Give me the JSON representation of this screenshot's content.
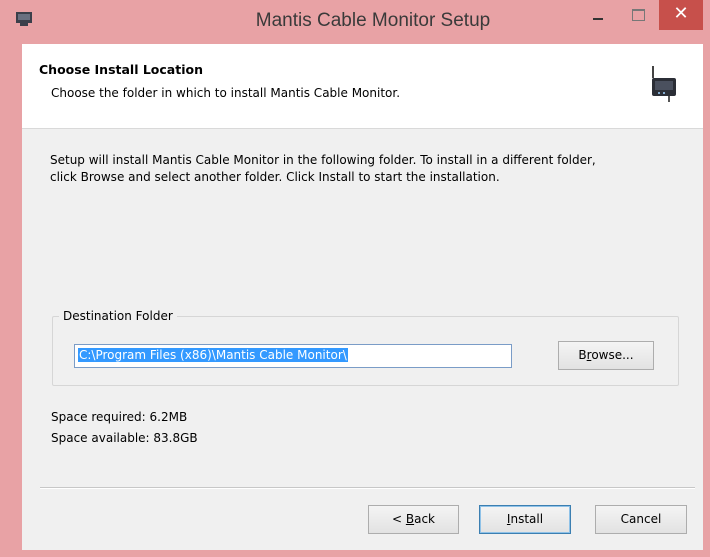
{
  "window": {
    "title": "Mantis Cable Monitor Setup",
    "icon": "installer-icon",
    "controls": {
      "minimize": "minimize-icon",
      "maximize": "maximize-icon",
      "close": "close-icon"
    },
    "accent_color": "#e8a2a5",
    "close_color": "#c7504b"
  },
  "header": {
    "title": "Choose Install Location",
    "subtitle": "Choose the folder in which to install Mantis Cable Monitor.",
    "icon": "device-icon"
  },
  "intro": {
    "line1": "Setup will install Mantis Cable Monitor in the following folder. To install in a different folder,",
    "line2": "click Browse and select another folder. Click Install to start the installation."
  },
  "destination": {
    "legend": "Destination Folder",
    "path": "C:\\Program Files (x86)\\Mantis Cable Monitor\\",
    "browse_prefix": "B",
    "browse_accel": "r",
    "browse_suffix": "owse..."
  },
  "space": {
    "required": "Space required: 6.2MB",
    "available": "Space available: 83.8GB"
  },
  "buttons": {
    "back_prefix": "< ",
    "back_accel": "B",
    "back_suffix": "ack",
    "install_accel": "I",
    "install_suffix": "nstall",
    "cancel": "Cancel"
  }
}
